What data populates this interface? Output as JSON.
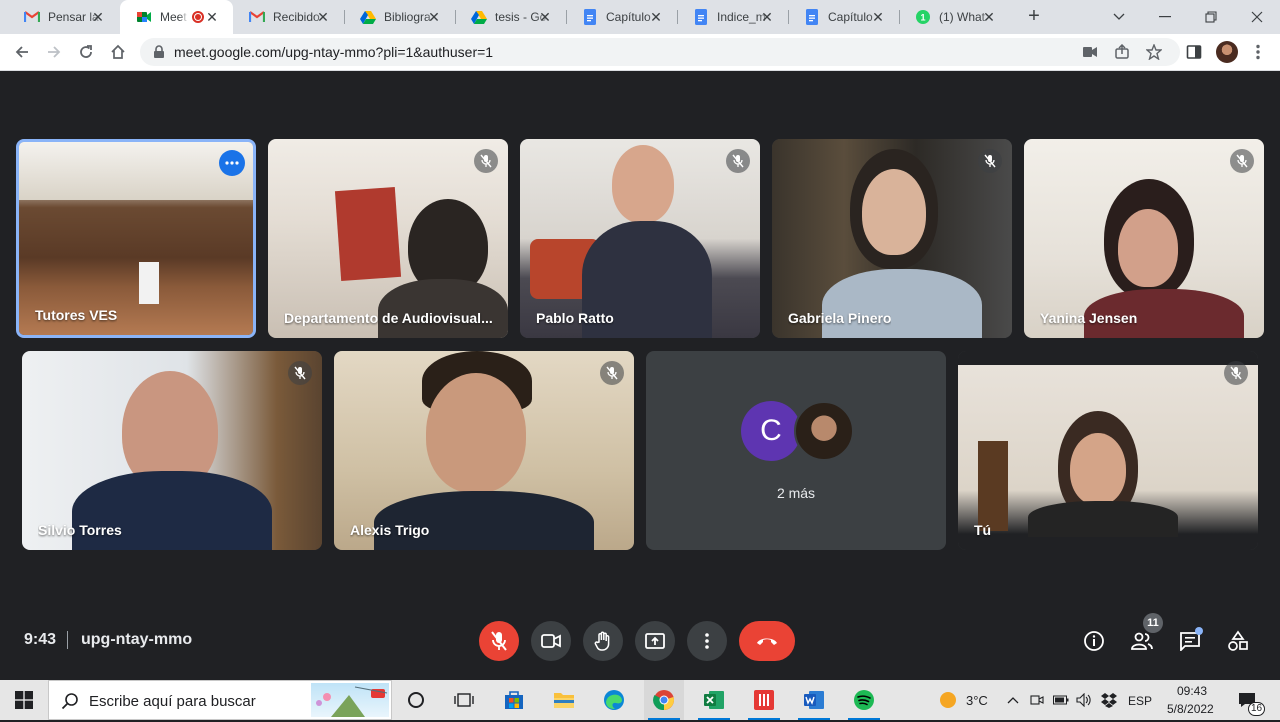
{
  "browser": {
    "tabs": [
      {
        "title": "Pensar la",
        "icon": "gmail-icon"
      },
      {
        "title": "Meet",
        "icon": "meet-icon",
        "active": true,
        "recording": true
      },
      {
        "title": "Recibido",
        "icon": "gmail-icon"
      },
      {
        "title": "Bibliogra",
        "icon": "drive-icon"
      },
      {
        "title": "tesis - Go",
        "icon": "drive-icon"
      },
      {
        "title": "Capítulo",
        "icon": "docs-icon"
      },
      {
        "title": "Indice_m",
        "icon": "docs-icon"
      },
      {
        "title": "Capítulo",
        "icon": "docs-icon"
      },
      {
        "title": "(1) What",
        "icon": "whatsapp-icon"
      }
    ],
    "new_tab_label": "+",
    "url": "meet.google.com/upg-ntay-mmo?pli=1&authuser=1"
  },
  "meet": {
    "participants_row1": [
      {
        "name": "Tutores VES",
        "pinned": true
      },
      {
        "name": "Departamento de Audiovisual...",
        "muted": true
      },
      {
        "name": "Pablo Ratto",
        "muted": true
      },
      {
        "name": "Gabriela Pinero",
        "muted": true
      },
      {
        "name": "Yanina Jensen",
        "muted": true
      }
    ],
    "participants_row2": [
      {
        "name": "Silvio Torres",
        "muted": true
      },
      {
        "name": "Alexis Trigo",
        "muted": true
      },
      {
        "name": "Tú",
        "muted": true
      }
    ],
    "more_tile": {
      "avatar_letter": "C",
      "label": "2 más",
      "avatar_color": "#5e35b1"
    },
    "time": "9:43",
    "meeting_code": "upg-ntay-mmo",
    "people_count": "11",
    "colors": {
      "background": "#202124",
      "tile": "#3c4043",
      "danger": "#ea4335",
      "pinned_border": "#8ab4f8"
    }
  },
  "taskbar": {
    "search_placeholder": "Escribe aquí para buscar",
    "weather": "3°C",
    "language": "ESP",
    "clock_time": "09:43",
    "clock_date": "5/8/2022",
    "notifications": "16"
  }
}
